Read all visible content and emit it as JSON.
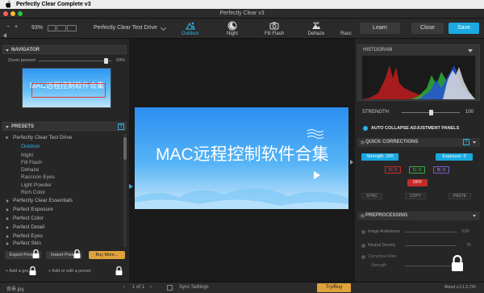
{
  "menubar": {
    "app_name": "Perfectly Clear Complete v3"
  },
  "window": {
    "title": "Perfectly Clear v3"
  },
  "toolbar": {
    "zoom": "93%",
    "preset_name": "Perfectly Clear Test Drive",
    "presets": [
      {
        "label": "Outdoor",
        "icon": "outdoor-icon",
        "active": true
      },
      {
        "label": "Night",
        "icon": "night-icon"
      },
      {
        "label": "Fill Flash",
        "icon": "fill-flash-icon"
      },
      {
        "label": "Dehaze",
        "icon": "dehaze-icon"
      },
      {
        "label": "Racc"
      }
    ],
    "learn_label": "Learn",
    "close_label": "Close",
    "save_label": "Save"
  },
  "navigator": {
    "title": "NAVIGATOR",
    "zoom_label": "Zoom percent",
    "zoom_value": "93%",
    "zoom_fraction": 0.93,
    "thumb_text": "MAC远程控制软件合集"
  },
  "presets": {
    "title": "PRESETS",
    "help": "?",
    "group_open": "Perfectly Clear Test Drive",
    "items": [
      "Outdoor",
      "Night",
      "Fill Flash",
      "Dehaze",
      "Raccoon Eyes",
      "Light Powder",
      "Rich Color"
    ],
    "groups": [
      "Perfectly Clear Essentials",
      "Perfect Exposure",
      "Perfect Color",
      "Perfect Detail",
      "Perfect Eyes",
      "Perfect Skin"
    ],
    "export_label": "Export Preset",
    "import_label": "Import Preset",
    "buy_label": "Buy More...",
    "add_group_label": "+ Add a gro",
    "add_preset_label": "+ Add or edit a preset"
  },
  "image": {
    "text": "MAC远程控制软件合集"
  },
  "histogram": {
    "title": "HISTOGRAM"
  },
  "strength": {
    "label": "STRENGTH",
    "value": "100",
    "fraction": 0.5
  },
  "auto_collapse": {
    "label": "AUTO COLLAPSE ADJUSTMENT PANELS"
  },
  "quick": {
    "title": "QUICK CORRECTIONS",
    "strength_chip": "Strength: 100",
    "exposure_chip": "Exposure: 0",
    "r": "R: 0",
    "g": "G: 0",
    "b": "B: 0",
    "off": "OFF",
    "sync": "SYNC",
    "copy": "COPY",
    "paste": "PASTE",
    "help": "?"
  },
  "preprocessing": {
    "title": "PREPROCESSING",
    "image_ambulance": "Image Ambulance",
    "image_ambulance_value": "0.00",
    "neutral_density": "Neutral Density",
    "neutral_density_value": "70",
    "corrective_filter": "Corrective Filter",
    "strength_label": "Strength"
  },
  "status": {
    "filename": "背景.jpg",
    "page": "1 of 1",
    "sync_settings": "Sync Settings",
    "try_buy": "Try/Buy",
    "about": "About v.3.1.0.730"
  },
  "colors": {
    "accent": "#2fb0e8",
    "save": "#1aa9e0",
    "buy": "#e0a23a",
    "off_red": "#c42b2b"
  }
}
